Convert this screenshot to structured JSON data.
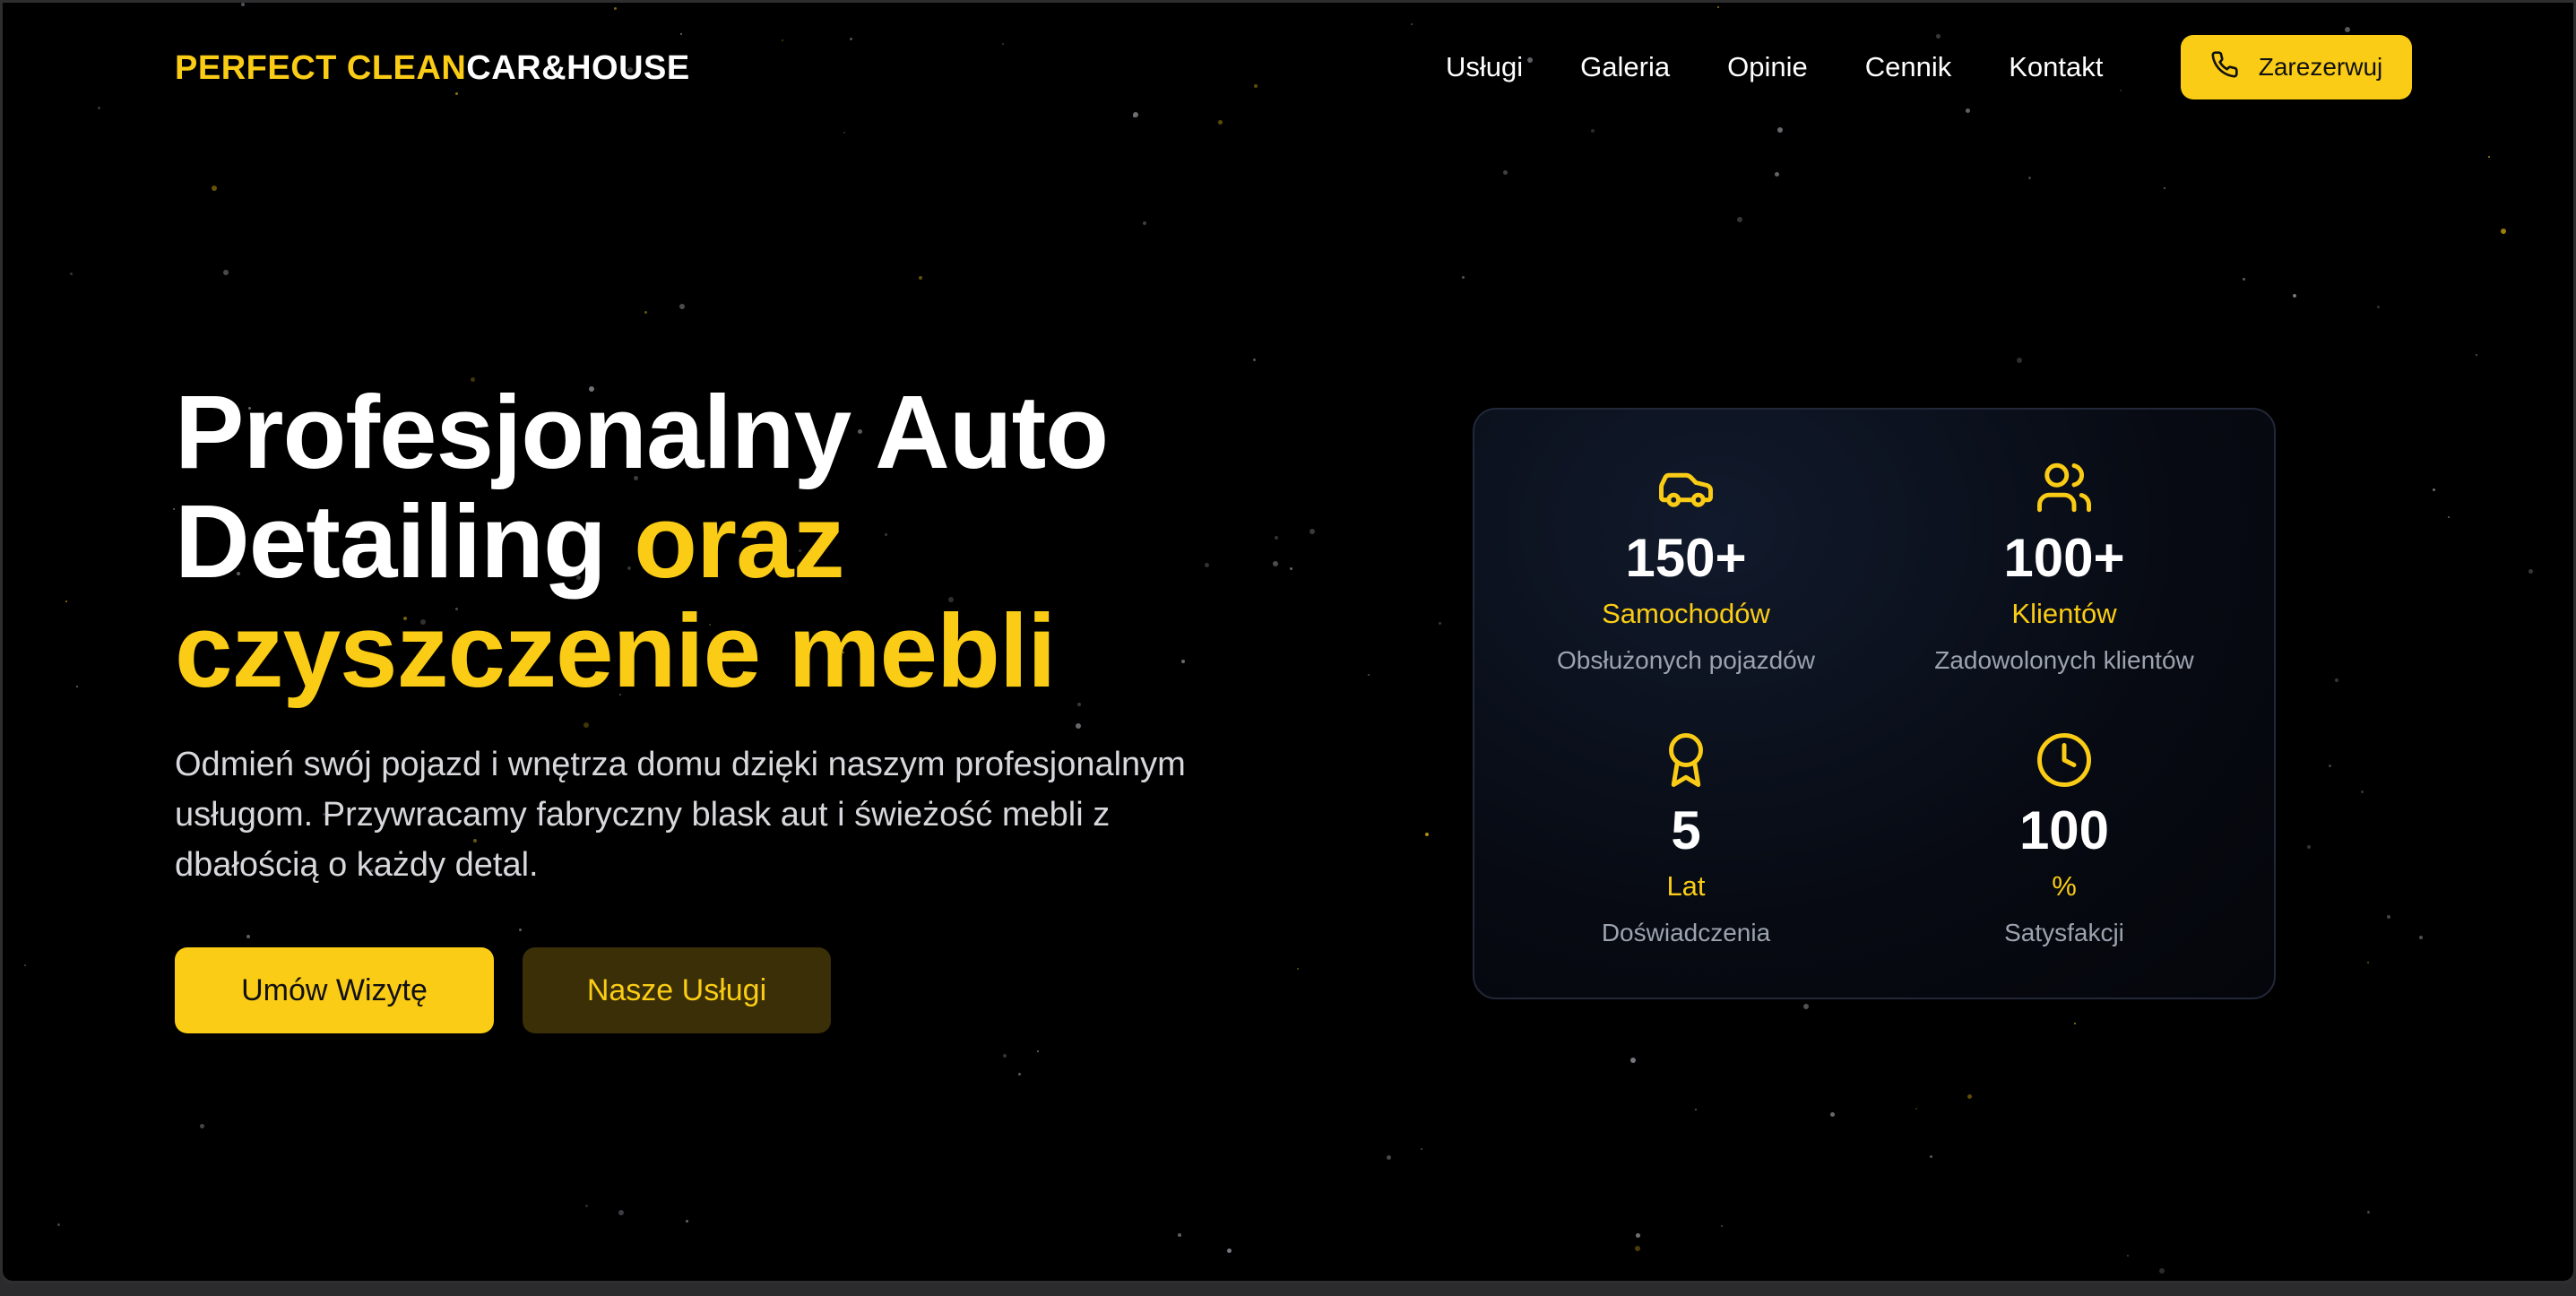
{
  "brand": {
    "logo_part1": "PERFECT CLEAN",
    "logo_part2": "CAR&HOUSE",
    "accent_color": "#facc15",
    "background_color": "#000000"
  },
  "nav": {
    "items": [
      {
        "label": "Usługi"
      },
      {
        "label": "Galeria"
      },
      {
        "label": "Opinie"
      },
      {
        "label": "Cennik"
      },
      {
        "label": "Kontakt"
      }
    ],
    "cta_label": "Zarezerwuj",
    "cta_icon": "phone-icon"
  },
  "hero": {
    "title_line1": "Profesjonalny Auto",
    "title_line2_white": "Detailing ",
    "title_line2_accent": "oraz",
    "title_line3_accent": "czyszczenie mebli",
    "description": "Odmień swój pojazd i wnętrza domu dzięki naszym profesjonalnym usługom. Przywracamy fabryczny blask aut i świeżość mebli z dbałością o każdy detal.",
    "primary_button": "Umów Wizytę",
    "secondary_button": "Nasze Usługi"
  },
  "stats": [
    {
      "icon": "car-icon",
      "value": "150+",
      "unit": "Samochodów",
      "desc": "Obsłużonych pojazdów"
    },
    {
      "icon": "users-icon",
      "value": "100+",
      "unit": "Klientów",
      "desc": "Zadowolonych klientów"
    },
    {
      "icon": "award-icon",
      "value": "5",
      "unit": "Lat",
      "desc": "Doświadczenia"
    },
    {
      "icon": "clock-icon",
      "value": "100",
      "unit": "%",
      "desc": "Satysfakcji"
    }
  ]
}
